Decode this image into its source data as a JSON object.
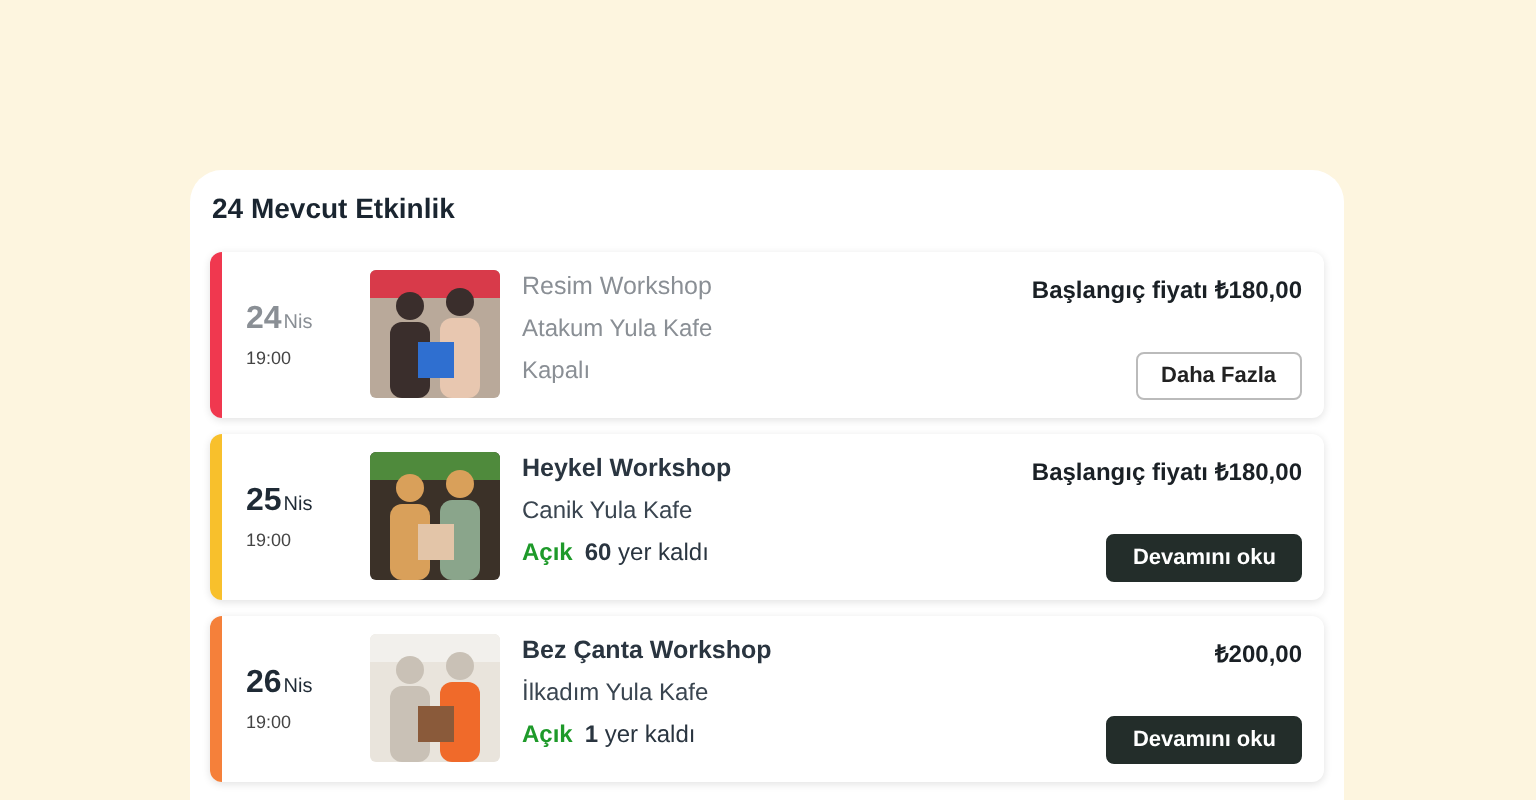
{
  "heading": "24 Mevcut Etkinlik",
  "events": [
    {
      "color": "#f0384f",
      "day": "24",
      "month": "Nis",
      "time": "19:00",
      "title": "Resim Workshop",
      "venue": "Atakum Yula Kafe",
      "open": false,
      "status": "Kapalı",
      "price": "Başlangıç fiyatı ₺180,00",
      "button": "Daha Fazla"
    },
    {
      "color": "#f8c02c",
      "day": "25",
      "month": "Nis",
      "time": "19:00",
      "title": "Heykel Workshop",
      "venue": "Canik Yula Kafe",
      "open": true,
      "status": "Açık",
      "seats": "60",
      "seats_label": "yer kaldı",
      "price": "Başlangıç fiyatı ₺180,00",
      "button": "Devamını oku"
    },
    {
      "color": "#f5803a",
      "day": "26",
      "month": "Nis",
      "time": "19:00",
      "title": "Bez Çanta Workshop",
      "venue": "İlkadım Yula Kafe",
      "open": true,
      "status": "Açık",
      "seats": "1",
      "seats_label": "yer kaldı",
      "price": "₺200,00",
      "button": "Devamını oku"
    }
  ]
}
